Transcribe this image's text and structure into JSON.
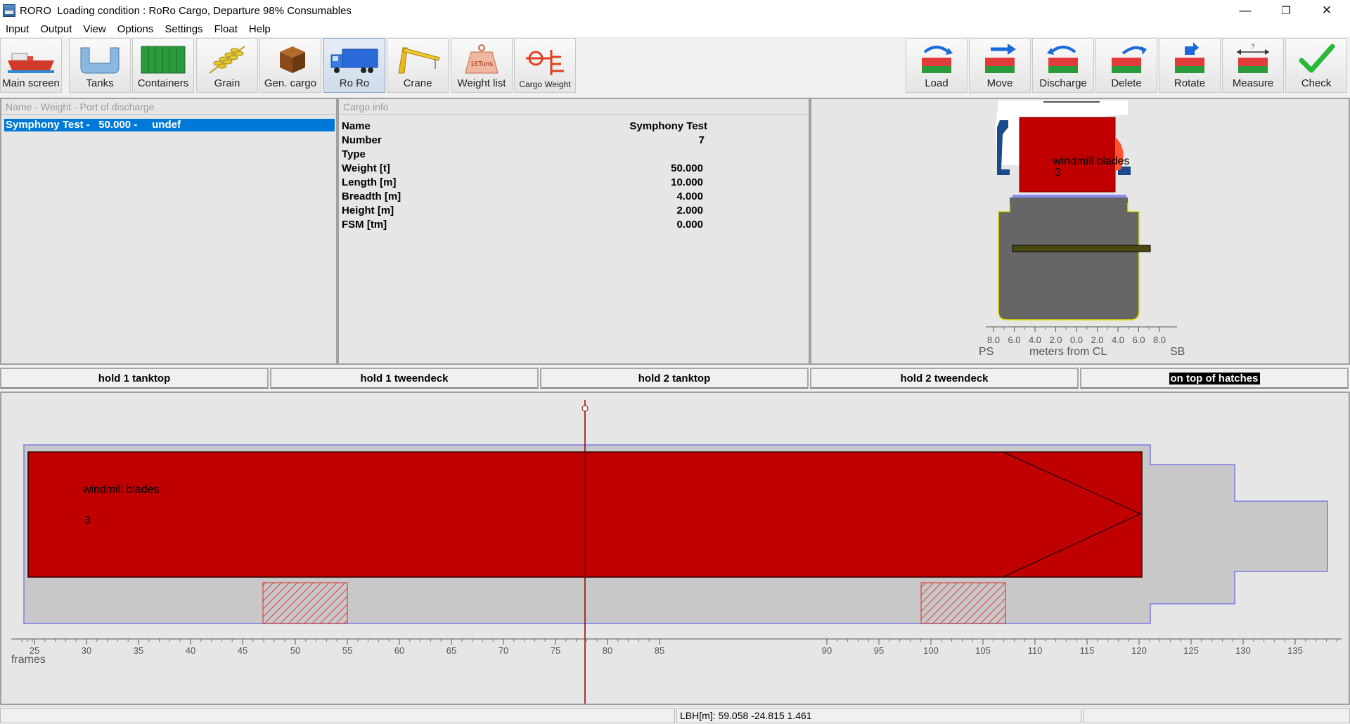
{
  "window": {
    "app_name": "RORO",
    "title": "Loading condition : RoRo Cargo, Departure 98% Consumables",
    "minimize": "—",
    "restore": "❐",
    "close": "✕"
  },
  "menu": [
    "Input",
    "Output",
    "View",
    "Options",
    "Settings",
    "Float",
    "Help"
  ],
  "toolbar_left": [
    {
      "label": "Main screen",
      "icon": "ship-icon"
    },
    {
      "label": "Tanks",
      "icon": "tank-icon"
    },
    {
      "label": "Containers",
      "icon": "container-icon"
    },
    {
      "label": "Grain",
      "icon": "grain-icon"
    },
    {
      "label": "Gen. cargo",
      "icon": "box-icon"
    },
    {
      "label": "Ro Ro",
      "icon": "truck-icon"
    },
    {
      "label": "Crane",
      "icon": "crane-icon"
    },
    {
      "label": "Weight list",
      "icon": "weight-icon"
    },
    {
      "label": "Cargo Weight",
      "icon": "scale-icon"
    }
  ],
  "toolbar_right": [
    {
      "label": "Load",
      "icon": "load-icon"
    },
    {
      "label": "Move",
      "icon": "move-icon"
    },
    {
      "label": "Discharge",
      "icon": "discharge-icon"
    },
    {
      "label": "Delete",
      "icon": "delete-icon"
    },
    {
      "label": "Rotate",
      "icon": "rotate-icon"
    },
    {
      "label": "Measure",
      "icon": "measure-icon"
    },
    {
      "label": "Check",
      "icon": "checkmark-icon"
    }
  ],
  "weight_icon_text": "16Tons",
  "list_panel": {
    "header": "Name - Weight - Port of discharge",
    "selected_item": "Symphony Test -   50.000 -     undef"
  },
  "cargo_info": {
    "header": "Cargo info",
    "rows": [
      {
        "key": "Name",
        "value": "Symphony Test"
      },
      {
        "key": "Number",
        "value": "7"
      },
      {
        "key": "Type",
        "value": ""
      },
      {
        "key": "Weight [t]",
        "value": "50.000"
      },
      {
        "key": "Length [m]",
        "value": "10.000"
      },
      {
        "key": "Breadth [m]",
        "value": "4.000"
      },
      {
        "key": "Height [m]",
        "value": "2.000"
      },
      {
        "key": "FSM [tm]",
        "value": "0.000"
      }
    ]
  },
  "section_view": {
    "cargo_label": "windmill blades",
    "cargo_number": "3",
    "ticks": [
      "8.0",
      "6.0",
      "4.0",
      "2.0",
      "0.0",
      "2.0",
      "4.0",
      "6.0",
      "8.0"
    ],
    "ps": "PS",
    "axis_label": "meters from CL",
    "sb": "SB"
  },
  "tabs": [
    "hold 1 tanktop",
    "hold 1 tweendeck",
    "hold 2 tanktop",
    "hold 2 tweendeck",
    "on top of hatches"
  ],
  "selected_tab": 4,
  "plan_view": {
    "cargo_label": "windmill blades",
    "cargo_number": "3",
    "frames_label": "frames",
    "frame_ticks": [
      "25",
      "30",
      "35",
      "40",
      "45",
      "50",
      "55",
      "60",
      "65",
      "70",
      "75",
      "80",
      "85",
      "90",
      "95",
      "100",
      "105",
      "110",
      "115",
      "120",
      "125",
      "130",
      "135"
    ]
  },
  "status": {
    "lbh": "LBH[m]: 59.058   -24.815   1.461"
  },
  "colors": {
    "cargo_red": "#c00000",
    "hull_gray": "#666666",
    "plan_gray": "#c8c8c8",
    "outline_blue": "#7b7bea",
    "selection_blue": "#0078d7"
  }
}
